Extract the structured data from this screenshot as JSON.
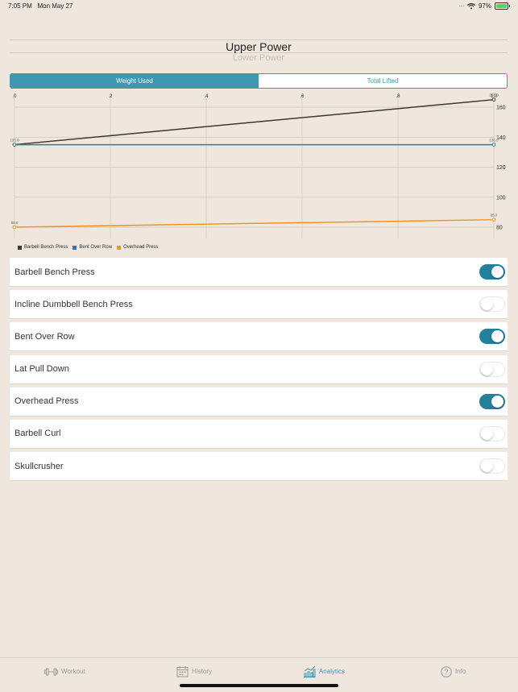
{
  "status_bar": {
    "time": "7:05 PM",
    "date": "Mon May 27",
    "battery": "97%",
    "battery_level": 0.97
  },
  "picker": {
    "selected": "Upper Power",
    "next": "Lower Power"
  },
  "segmented": {
    "options": [
      "Weight Used",
      "Total Lifted"
    ],
    "selected_index": 0
  },
  "chart_data": {
    "type": "line",
    "x_ticks": [
      ".0",
      ".2",
      ".4",
      ".6",
      ".8",
      "1.0"
    ],
    "xlim": [
      0,
      1
    ],
    "y_ticks": [
      "80",
      "100",
      "120",
      "140",
      "160"
    ],
    "ylim": [
      80,
      160
    ],
    "grid": true,
    "series": [
      {
        "name": "Barbell Bench Press",
        "color": "#3d3734",
        "x": [
          0,
          1
        ],
        "values": [
          135,
          165
        ],
        "point_labels": [
          "",
          "165.0"
        ]
      },
      {
        "name": "Bent Over Row",
        "color": "#1f83a8",
        "x": [
          0,
          1
        ],
        "values": [
          135,
          135
        ],
        "point_labels": [
          "135.0",
          "135.0"
        ]
      },
      {
        "name": "Overhead Press",
        "color": "#f0951e",
        "x": [
          0,
          1
        ],
        "values": [
          80,
          85
        ],
        "point_labels": [
          "80.0",
          "85.0"
        ]
      }
    ],
    "legend_position": "bottom-left"
  },
  "exercises": [
    {
      "name": "Barbell Bench Press",
      "enabled": true
    },
    {
      "name": "Incline Dumbbell Bench Press",
      "enabled": false
    },
    {
      "name": "Bent Over Row",
      "enabled": true
    },
    {
      "name": "Lat Pull Down",
      "enabled": false
    },
    {
      "name": "Overhead Press",
      "enabled": true
    },
    {
      "name": "Barbell Curl",
      "enabled": false
    },
    {
      "name": "Skullcrusher",
      "enabled": false
    }
  ],
  "tabs": [
    {
      "label": "Workout",
      "icon": "dumbbell-icon",
      "active": false
    },
    {
      "label": "History",
      "icon": "calendar-icon",
      "active": false
    },
    {
      "label": "Analytics",
      "icon": "chart-icon",
      "active": true
    },
    {
      "label": "Info",
      "icon": "question-icon",
      "active": false
    }
  ],
  "colors": {
    "accent": "#3e98b4",
    "toggle_on": "#23809a",
    "background": "#efe6dd"
  }
}
